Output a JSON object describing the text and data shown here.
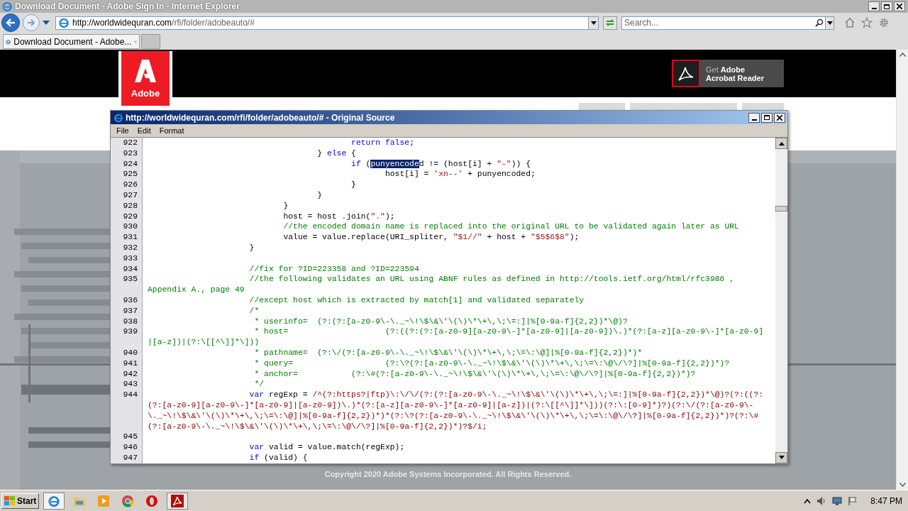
{
  "window": {
    "title": "Download Document - Adobe Sign In - Internet Explorer"
  },
  "address_bar": {
    "url_domain": "http://worldwidequran.com",
    "url_path": "/rfi/folder/adobeauto/#"
  },
  "search": {
    "placeholder": "Search..."
  },
  "tabs": [
    {
      "label": "Download Document - Adobe...",
      "selected": true
    }
  ],
  "page": {
    "logo_text": "Adobe",
    "reader_button": {
      "line_1": "Get **Adobe**",
      "line_2": "Acrobat Reader"
    },
    "copyright": "Copyright 2020 Adobe Systems Incorporated. All Rights Reserved."
  },
  "source_window": {
    "title": "http://worldwidequran.com/rfi/folder/adobeauto/# - Original Source",
    "menu": [
      "File",
      "Edit",
      "Format"
    ],
    "lines": [
      {
        "number": "922",
        "rows": [
          [
            {
              "kind": "plain",
              "text": "                                          "
            },
            {
              "kind": "keyword",
              "text": "return"
            },
            {
              "kind": "plain",
              "text": " "
            },
            {
              "kind": "keyword",
              "text": "false"
            },
            {
              "kind": "plain",
              "text": ";"
            }
          ]
        ]
      },
      {
        "number": "923",
        "rows": [
          [
            {
              "kind": "plain",
              "text": "                                   } "
            },
            {
              "kind": "keyword",
              "text": "else"
            },
            {
              "kind": "plain",
              "text": " {"
            }
          ]
        ]
      },
      {
        "number": "924",
        "rows": [
          [
            {
              "kind": "plain",
              "text": "                                          "
            },
            {
              "kind": "keyword",
              "text": "if"
            },
            {
              "kind": "plain",
              "text": " ("
            },
            {
              "kind": "selected",
              "text": "punyencode"
            },
            {
              "kind": "plain",
              "text": "d != (host[i] + "
            },
            {
              "kind": "string",
              "text": "\"-\""
            },
            {
              "kind": "plain",
              "text": ")) {"
            }
          ]
        ]
      },
      {
        "number": "925",
        "rows": [
          [
            {
              "kind": "plain",
              "text": "                                                 host[i] = "
            },
            {
              "kind": "string",
              "text": "'xn--'"
            },
            {
              "kind": "plain",
              "text": " + punyencoded;"
            }
          ]
        ]
      },
      {
        "number": "926",
        "rows": [
          [
            {
              "kind": "plain",
              "text": "                                          }"
            }
          ]
        ]
      },
      {
        "number": "927",
        "rows": [
          [
            {
              "kind": "plain",
              "text": "                                   }"
            }
          ]
        ]
      },
      {
        "number": "928",
        "rows": [
          [
            {
              "kind": "plain",
              "text": "                            }"
            }
          ]
        ]
      },
      {
        "number": "929",
        "rows": [
          [
            {
              "kind": "plain",
              "text": "                            host = host .join("
            },
            {
              "kind": "string",
              "text": "\".\""
            },
            {
              "kind": "plain",
              "text": ");"
            }
          ]
        ]
      },
      {
        "number": "930",
        "rows": [
          [
            {
              "kind": "comment",
              "text": "                            //the encoded domain name is replaced into the original URL to be validated again later as URL"
            }
          ]
        ]
      },
      {
        "number": "931",
        "rows": [
          [
            {
              "kind": "plain",
              "text": "                            value = value.replace(URI_spliter, "
            },
            {
              "kind": "string",
              "text": "\"$1//\""
            },
            {
              "kind": "plain",
              "text": " + host + "
            },
            {
              "kind": "string",
              "text": "\"$5$6$8\""
            },
            {
              "kind": "plain",
              "text": ");"
            }
          ]
        ]
      },
      {
        "number": "932",
        "rows": [
          [
            {
              "kind": "plain",
              "text": "                     }"
            }
          ]
        ]
      },
      {
        "number": "933"
      },
      {
        "number": "934",
        "rows": [
          [
            {
              "kind": "comment",
              "text": "                     //fix for ?ID=223358 and ?ID=223594"
            }
          ]
        ]
      },
      {
        "number": "935",
        "rows": [
          [
            {
              "kind": "comment",
              "text": "                     //the following validates an URL using ABNF rules as defined in http://tools.ietf.org/html/rfc3986 ,"
            }
          ],
          [
            {
              "kind": "comment",
              "text": "Appendix A., page 49"
            }
          ]
        ]
      },
      {
        "number": "936",
        "rows": [
          [
            {
              "kind": "comment",
              "text": "                     //except host which is extracted by match[1] and validated separately"
            }
          ]
        ]
      },
      {
        "number": "937",
        "rows": [
          [
            {
              "kind": "comment",
              "text": "                     /*"
            }
          ]
        ]
      },
      {
        "number": "938",
        "rows": [
          [
            {
              "kind": "comment",
              "text": "                      * userinfo=  (?:(?:[a-z0-9\\-\\._~\\!\\$\\&\\'\\(\\)\\*\\+\\,\\;\\=:]|%[0-9a-f]{2,2})*\\@)?"
            }
          ]
        ]
      },
      {
        "number": "939",
        "rows": [
          [
            {
              "kind": "comment",
              "text": "                      * host=                    (?:((?:(?:[a-z0-9][a-z0-9\\-]*[a-z0-9]|[a-z0-9])\\.)*(?:[a-z][a-z0-9\\-]*[a-z0-9]"
            }
          ],
          [
            {
              "kind": "comment",
              "text": "|[a-z])|(?:\\[[^\\]]*\\]))"
            }
          ]
        ]
      },
      {
        "number": "940",
        "rows": [
          [
            {
              "kind": "comment",
              "text": "                      * pathname=  (?:\\/(?:[a-z0-9\\-\\._~\\!\\$\\&\\'\\(\\)\\*\\+\\,\\;\\=\\:\\@]|%[0-9a-f]{2,2})*)*"
            }
          ]
        ]
      },
      {
        "number": "941",
        "rows": [
          [
            {
              "kind": "comment",
              "text": "                      * query=                   (?:\\?(?:[a-z0-9\\-\\._~\\!\\$\\&\\'\\(\\)\\*\\+\\,\\;\\=\\:\\@\\/\\?]|%[0-9a-f]{2,2})*)?"
            }
          ]
        ]
      },
      {
        "number": "942",
        "rows": [
          [
            {
              "kind": "comment",
              "text": "                      * anchor=           (?:\\#(?:[a-z0-9\\-\\._~\\!\\$\\&\\'\\(\\)\\*\\+\\,\\;\\=\\:\\@\\/\\?]|%[0-9a-f]{2,2})*)?"
            }
          ]
        ]
      },
      {
        "number": "943",
        "rows": [
          [
            {
              "kind": "comment",
              "text": "                      */"
            }
          ]
        ]
      },
      {
        "number": "944",
        "rows": [
          [
            {
              "kind": "plain",
              "text": "                     "
            },
            {
              "kind": "keyword",
              "text": "var"
            },
            {
              "kind": "plain",
              "text": " regExp = "
            },
            {
              "kind": "regex",
              "text": "/^(?:https?|ftp)\\:\\/\\/(?:(?:[a-z0-9\\-\\._~\\!\\$\\&\\'\\(\\)\\*\\+\\,\\;\\=:]|%[0-9a-f]{2,2})*\\@)?(?:((?:"
            }
          ],
          [
            {
              "kind": "regex",
              "text": "(?:[a-z0-9][a-z0-9\\-]*[a-z0-9]|[a-z0-9])\\.)*(?:[a-z][a-z0-9\\-]*[a-z0-9]|[a-z])|(?:\\[[^\\]]*\\]))(?:\\:[0-9]*)?)(?:\\/(?:[a-z0-9\\-"
            }
          ],
          [
            {
              "kind": "regex",
              "text": "\\._~\\!\\$\\&\\'\\(\\)\\*\\+\\,\\;\\=\\:\\@]|%[0-9a-f]{2,2})*)*(?:\\?(?:[a-z0-9\\-\\._~\\!\\$\\&\\'\\(\\)\\*\\+\\,\\;\\=\\:\\@\\/\\?]|%[0-9a-f]{2,2})*)?(?:\\#"
            }
          ],
          [
            {
              "kind": "regex",
              "text": "(?:[a-z0-9\\-\\._~\\!\\$\\&\\'\\(\\)\\*\\+\\,\\;\\=\\:\\@\\/\\?]|%[0-9a-f]{2,2})*)?$/i;"
            }
          ]
        ]
      },
      {
        "number": "945"
      },
      {
        "number": "946",
        "rows": [
          [
            {
              "kind": "plain",
              "text": "                     "
            },
            {
              "kind": "keyword",
              "text": "var"
            },
            {
              "kind": "plain",
              "text": " valid = value.match(regExp);"
            }
          ]
        ]
      },
      {
        "number": "947",
        "rows": [
          [
            {
              "kind": "plain",
              "text": "                     "
            },
            {
              "kind": "keyword",
              "text": "if"
            },
            {
              "kind": "plain",
              "text": " (valid) {"
            }
          ]
        ]
      }
    ]
  },
  "taskbar": {
    "start_label": "Start",
    "clock": "8:47 PM"
  }
}
